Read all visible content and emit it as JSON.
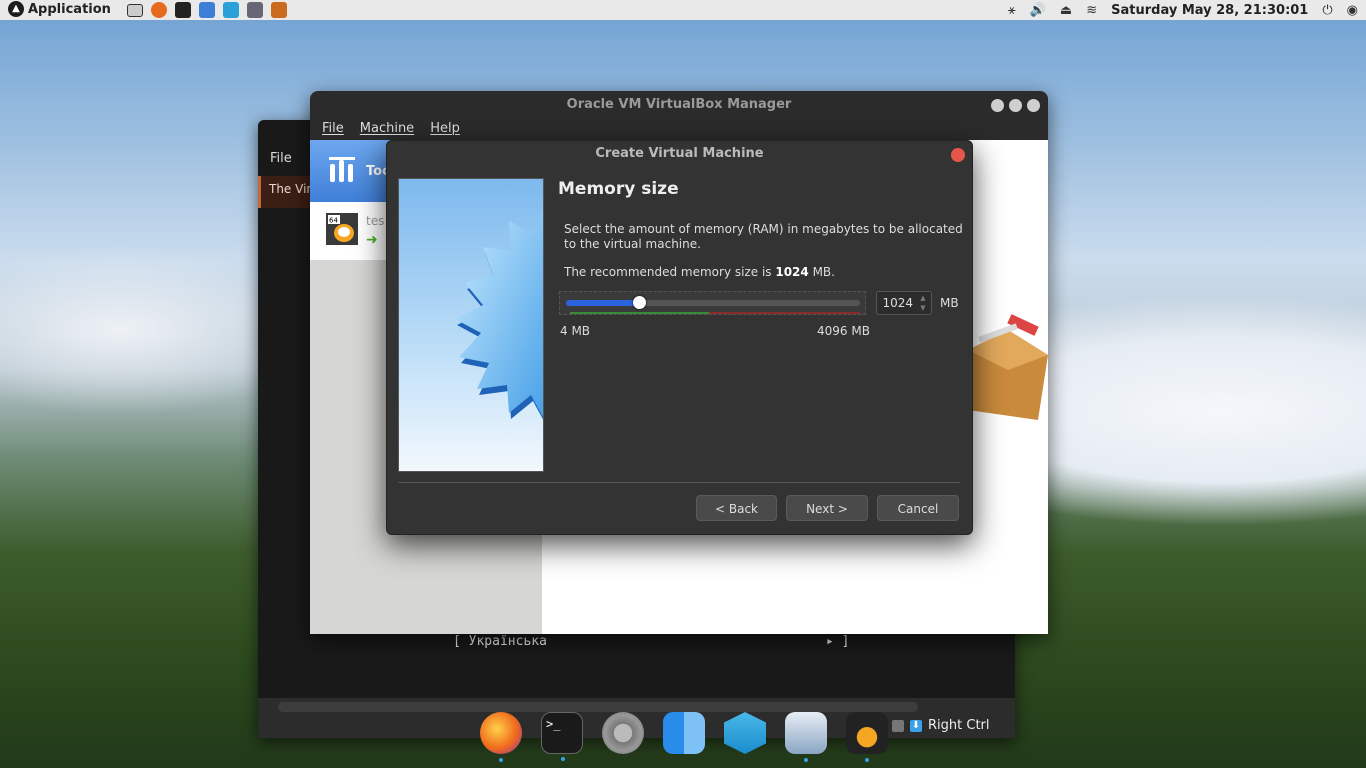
{
  "topbar": {
    "app_menu": "Application",
    "clock": "Saturday May 28, 21:30:01"
  },
  "terminal": {
    "menu_file": "File",
    "tab_label": "The Virt",
    "console_label": "[ Українська",
    "console_arrow": "▸ ]",
    "right_ctrl": "Right Ctrl"
  },
  "vbox_manager": {
    "title": "Oracle VM VirtualBox Manager",
    "menu": {
      "file": "File",
      "machine": "Machine",
      "help": "Help"
    },
    "tools_label": "Too",
    "vm_name": "tes"
  },
  "dialog": {
    "title": "Create Virtual Machine",
    "heading": "Memory size",
    "description": "Select the amount of memory (RAM) in megabytes to be allocated to the virtual machine.",
    "recommended_prefix": "The recommended memory size is ",
    "recommended_value": "1024",
    "recommended_suffix": " MB.",
    "memory_value": "1024",
    "memory_unit": "MB",
    "min_label": "4 MB",
    "max_label": "4096 MB",
    "slider_fraction": 0.25,
    "back_label": "< Back",
    "next_label": "Next >",
    "cancel_label": "Cancel"
  },
  "colors": {
    "accent_blue": "#2a63dc",
    "close_red": "#e6574b",
    "zone_green": "#3a8a3a",
    "zone_red": "#8a2a2a"
  },
  "dock": [
    "firefox-icon",
    "terminal-icon",
    "settings-icon",
    "finder-icon",
    "network-icon",
    "preview-icon",
    "virtualbox-icon"
  ]
}
